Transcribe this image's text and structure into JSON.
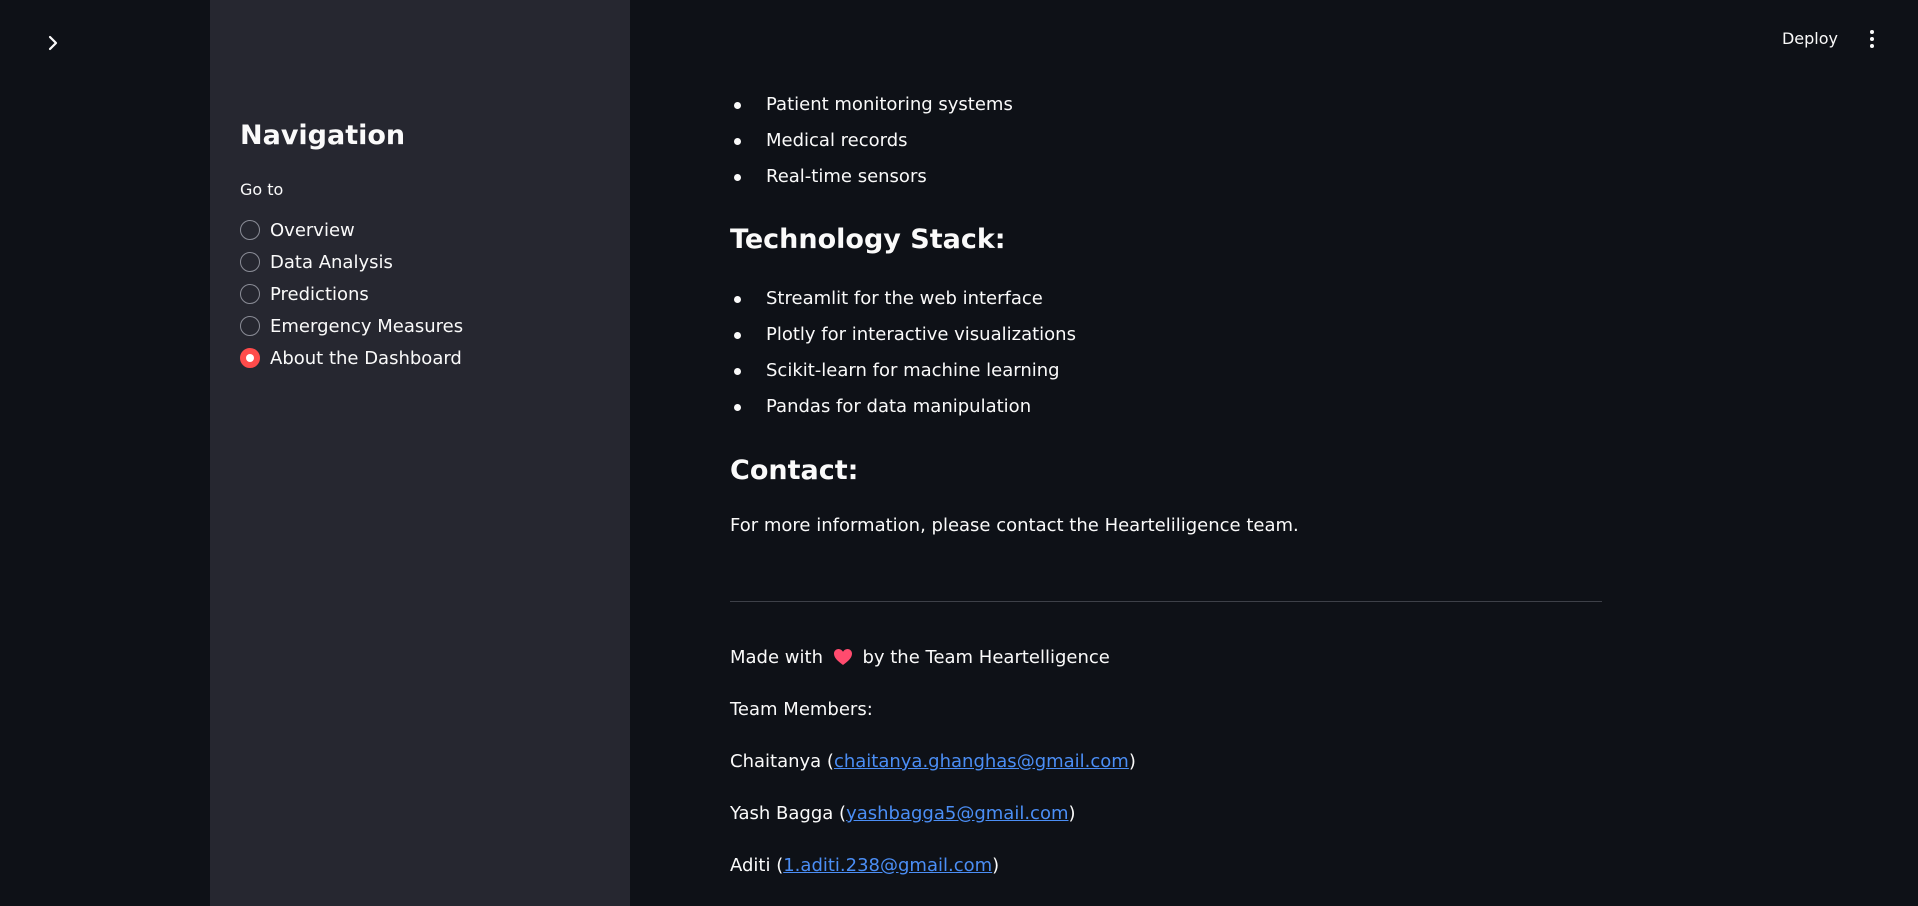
{
  "sidebar": {
    "title": "Navigation",
    "radio_label": "Go to",
    "options": [
      {
        "label": "Overview",
        "selected": false
      },
      {
        "label": "Data Analysis",
        "selected": false
      },
      {
        "label": "Predictions",
        "selected": false
      },
      {
        "label": "Emergency Measures",
        "selected": false
      },
      {
        "label": "About the Dashboard",
        "selected": true
      }
    ]
  },
  "toolbar": {
    "deploy_label": "Deploy",
    "menu_icon": "kebab-menu-icon",
    "expand_icon": "chevron-right-icon"
  },
  "content": {
    "data_sources": [
      "Patient monitoring systems",
      "Medical records",
      "Real-time sensors"
    ],
    "tech_heading": "Technology Stack:",
    "tech_stack": [
      "Streamlit for the web interface",
      "Plotly for interactive visualizations",
      "Scikit-learn for machine learning",
      "Pandas for data manipulation"
    ],
    "contact_heading": "Contact:",
    "contact_text": "For more information, please contact the Hearteliligence team.",
    "footer": {
      "made_with_prefix": "Made with",
      "made_with_suffix": "by the Team Heartelligence",
      "heart_icon": "heart-icon",
      "team_members_label": "Team Members:",
      "members": [
        {
          "name": "Chaitanya",
          "email": "chaitanya.ghanghas@gmail.com"
        },
        {
          "name": "Yash Bagga",
          "email": "yashbagga5@gmail.com"
        },
        {
          "name": "Aditi",
          "email": "1.aditi.238@gmail.com"
        }
      ]
    }
  },
  "colors": {
    "background": "#0e1117",
    "sidebar": "#262730",
    "accent": "#ff4b4b",
    "link": "#4b8ef5",
    "heart": "#ff4b6e"
  }
}
